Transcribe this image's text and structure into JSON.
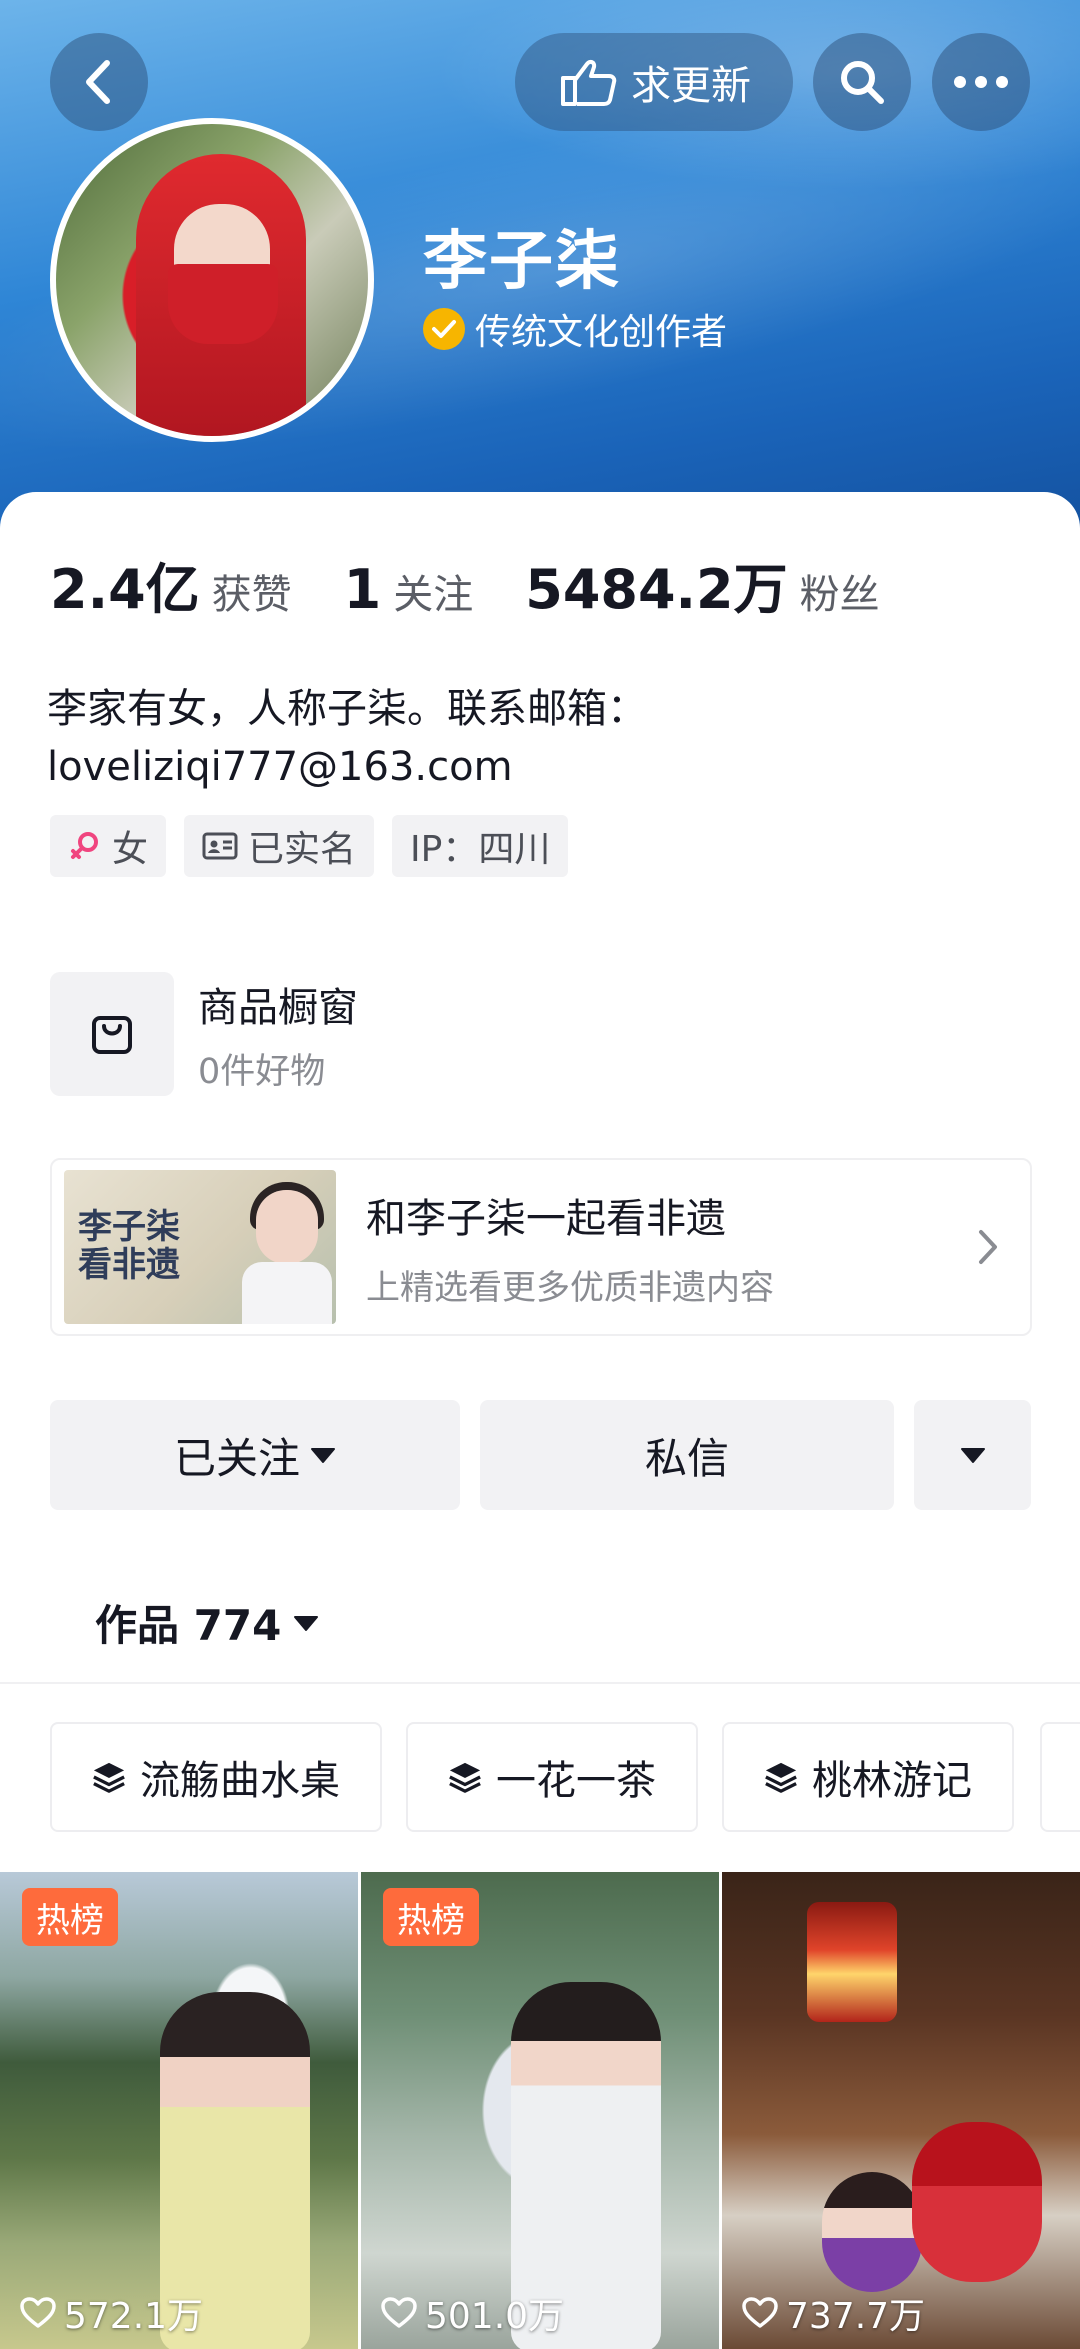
{
  "header": {
    "update_label": "求更新",
    "username": "李子柒",
    "verification": "传统文化创作者"
  },
  "stats": [
    {
      "value": "2.4亿",
      "label": "获赞"
    },
    {
      "value": "1",
      "label": "关注"
    },
    {
      "value": "5484.2万",
      "label": "粉丝"
    }
  ],
  "bio": {
    "line1": "李家有女，人称子柒。联系邮箱：",
    "line2": "loveliziqi777@163.com"
  },
  "tags": {
    "gender": "女",
    "realname": "已实名",
    "ip": "IP：四川"
  },
  "shop": {
    "title": "商品橱窗",
    "subtitle": "0件好物"
  },
  "banner": {
    "thumb_text1": "李子柒",
    "thumb_text2": "看非遗",
    "title": "和李子柒一起看非遗",
    "subtitle": "上精选看更多优质非遗内容"
  },
  "actions": {
    "follow_label": "已关注",
    "message_label": "私信"
  },
  "works": {
    "label": "作品 774"
  },
  "collections": [
    {
      "label": "流觞曲水桌"
    },
    {
      "label": "一花一茶"
    },
    {
      "label": "桃林游记"
    }
  ],
  "videos": [
    {
      "badge": "热榜",
      "likes": "572.1万"
    },
    {
      "badge": "热榜",
      "likes": "501.0万"
    },
    {
      "likes": "737.7万"
    }
  ],
  "colors": {
    "hot_badge": "#fe6b3c",
    "verify_badge": "#f7b500",
    "header_gradient_top": "#6db4ea",
    "header_gradient_bottom": "#134f9c"
  },
  "icons": {
    "back": "chevron-left-icon",
    "update": "pointing-hand-icon",
    "search": "search-icon",
    "more": "more-dots-icon",
    "verify": "check-badge-icon",
    "gender": "female-icon",
    "realname": "id-card-icon",
    "shop": "shopping-bag-icon",
    "banner_arrow": "chevron-right-icon",
    "dropdown": "triangle-down-icon",
    "collection": "layers-icon",
    "likes": "heart-outline-icon"
  }
}
